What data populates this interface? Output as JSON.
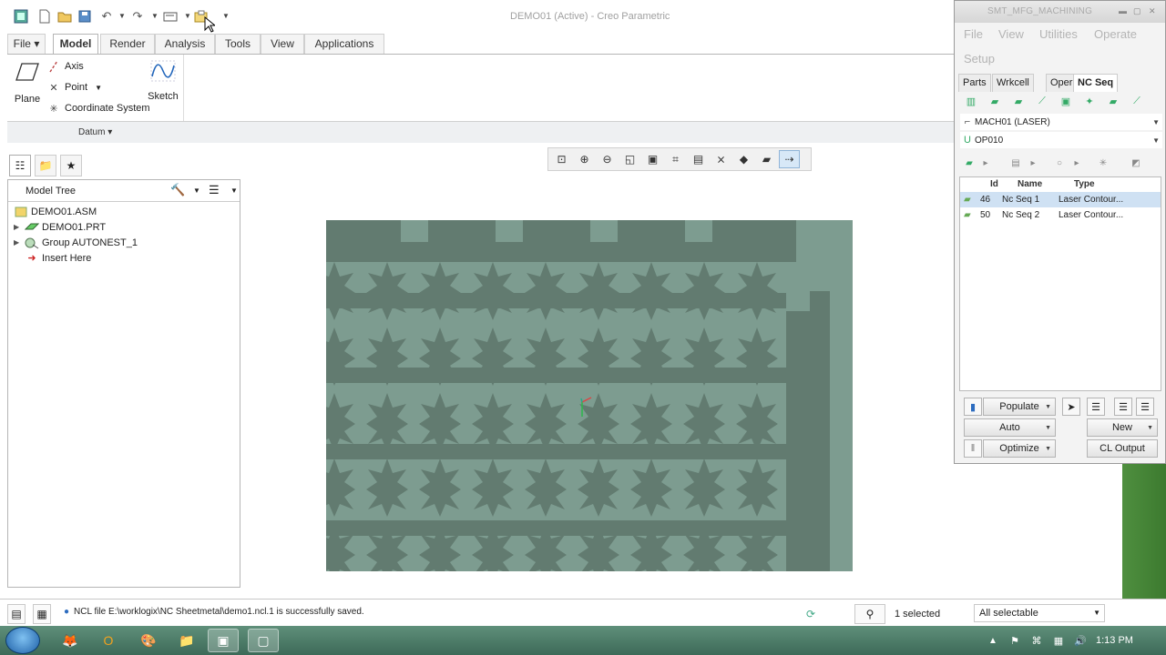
{
  "window": {
    "title": "DEMO01 (Active) - Creo Parametric"
  },
  "ribbon": {
    "tabs": [
      "File",
      "Model",
      "Render",
      "Analysis",
      "Tools",
      "View",
      "Applications"
    ],
    "active_tab": "Model",
    "datum": {
      "plane_label": "Plane",
      "axis_label": "Axis",
      "point_label": "Point",
      "csys_label": "Coordinate System",
      "sketch_label": "Sketch",
      "group_label": "Datum"
    }
  },
  "model_tree": {
    "title": "Model Tree",
    "items": [
      {
        "label": "DEMO01.ASM"
      },
      {
        "label": "DEMO01.PRT"
      },
      {
        "label": "Group AUTONEST_1"
      },
      {
        "label": "Insert Here"
      }
    ]
  },
  "status": {
    "message": "NCL file E:\\worklogix\\NC Sheetmetal\\demo1.ncl.1 is successfully saved.",
    "selected": "1 selected",
    "filter": "All selectable"
  },
  "dialog": {
    "title": "SMT_MFG_MACHINING",
    "menus": [
      "File",
      "View",
      "Utilities",
      "Operate",
      "Setup"
    ],
    "tabs": [
      "Parts",
      "Wrkcell",
      "Oper",
      "NC Seq"
    ],
    "active_tab": "NC Seq",
    "workcell": "MACH01 (LASER)",
    "operation": "OP010",
    "columns": [
      "Id",
      "Name",
      "Type"
    ],
    "rows": [
      {
        "id": "46",
        "name": "Nc Seq 1",
        "type": "Laser Contour..."
      },
      {
        "id": "50",
        "name": "Nc Seq 2",
        "type": "Laser Contour..."
      }
    ],
    "buttons": {
      "populate": "Populate",
      "auto": "Auto",
      "new": "New",
      "optimize": "Optimize",
      "cl_output": "CL Output"
    }
  },
  "taskbar": {
    "clock": "1:13 PM"
  },
  "colors": {
    "sheet": "#7d9c90",
    "part": "#627b70",
    "accent": "#2d6cbf"
  }
}
